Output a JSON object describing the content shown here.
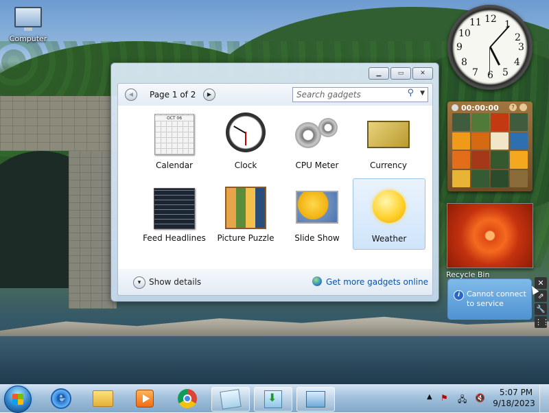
{
  "desktop": {
    "icons": {
      "computer": "Computer",
      "recycle_bin": "Recycle Bin"
    }
  },
  "gallery": {
    "page_text": "Page 1 of 2",
    "search_placeholder": "Search gadgets",
    "gadgets": [
      {
        "name": "Calendar",
        "icon": "calendar-icon"
      },
      {
        "name": "Clock",
        "icon": "clock-icon"
      },
      {
        "name": "CPU Meter",
        "icon": "cpu-meter-icon"
      },
      {
        "name": "Currency",
        "icon": "currency-icon"
      },
      {
        "name": "Feed Headlines",
        "icon": "feed-headlines-icon"
      },
      {
        "name": "Picture Puzzle",
        "icon": "picture-puzzle-icon"
      },
      {
        "name": "Slide Show",
        "icon": "slide-show-icon"
      },
      {
        "name": "Weather",
        "icon": "weather-sun-icon",
        "selected": true
      }
    ],
    "show_details": "Show details",
    "get_more": "Get more gadgets online",
    "calendar_month": "OCT 06"
  },
  "desktop_gadgets": {
    "clock_numbers": [
      "12",
      "1",
      "2",
      "3",
      "4",
      "5",
      "6",
      "7",
      "8",
      "9",
      "10",
      "11"
    ],
    "puzzle_timer": "00:00:00",
    "puzzle_help": "?",
    "weather_message": "Cannot connect to service"
  },
  "taskbar": {
    "apps": [
      "start",
      "internet-explorer",
      "windows-explorer",
      "windows-media-player",
      "google-chrome",
      "sticky-notes",
      "download",
      "gadget-gallery"
    ],
    "time": "5:07 PM",
    "date": "9/18/2023"
  },
  "colors": {
    "link": "#0b52a6",
    "selection": "#cfe4fa",
    "taskbar": "#96b9d7"
  }
}
